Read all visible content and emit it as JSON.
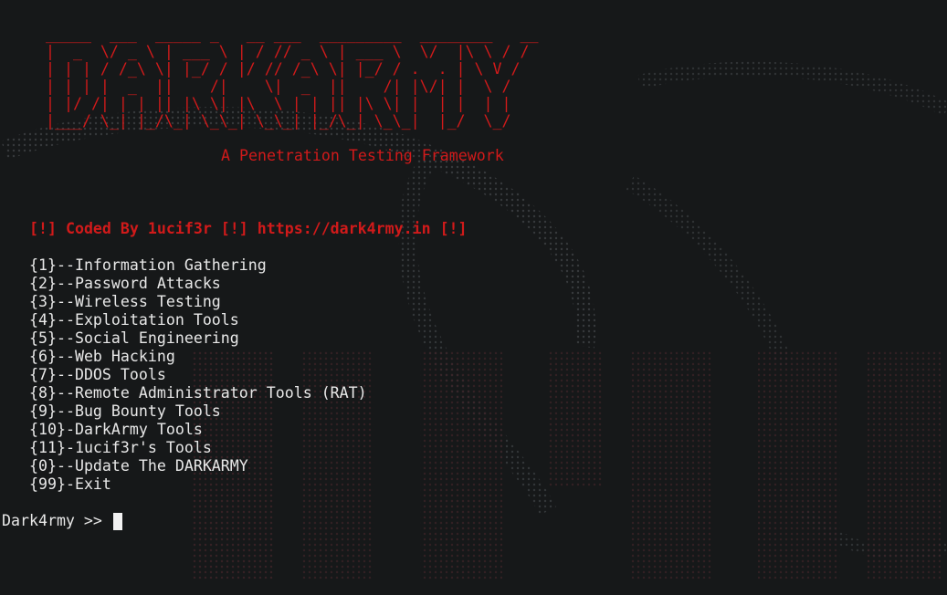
{
  "banner": {
    "ascii_art": " _____  ___  _____ _   __ ___  _________  ________   __\n |  _  \\/ _ \\ | ___ \\ | / // _ \\ | ___ \\  \\/  |\\ \\ / /\n | | | / /_\\ \\| |_/ / |/ // /_\\ \\| |_/ / .  . | \\ V / \n | | | |  _  ||    /|    \\|  _  ||    /| |\\/| |  \\ /  \n | |/ /| | | || |\\ \\| |\\  \\ | | || |\\ \\| |  | |  | |  \n |___/ \\_| |_/\\_| \\_\\_| \\_\\_| |_/\\_| \\_\\_|  |_/  \\_/  ",
    "subtitle": "A Penetration Testing Framework"
  },
  "coded_by": "[!] Coded By 1ucif3r [!] https://dark4rmy.in [!]",
  "menu": [
    "{1}--Information Gathering",
    "{2}--Password Attacks",
    "{3}--Wireless Testing",
    "{4}--Exploitation Tools",
    "{5}--Social Engineering",
    "{6}--Web Hacking",
    "{7}--DDOS Tools",
    "{8}--Remote Administrator Tools (RAT)",
    "{9}--Bug Bounty Tools",
    "{10}-DarkArmy Tools",
    "{11}-1ucif3r's Tools",
    "{0}--Update The DARKARMY",
    "{99}-Exit"
  ],
  "prompt": "Dark4rmy >> ",
  "colors": {
    "background": "#161819",
    "accent_red": "#d11a1a",
    "text": "#e8e8e8"
  }
}
